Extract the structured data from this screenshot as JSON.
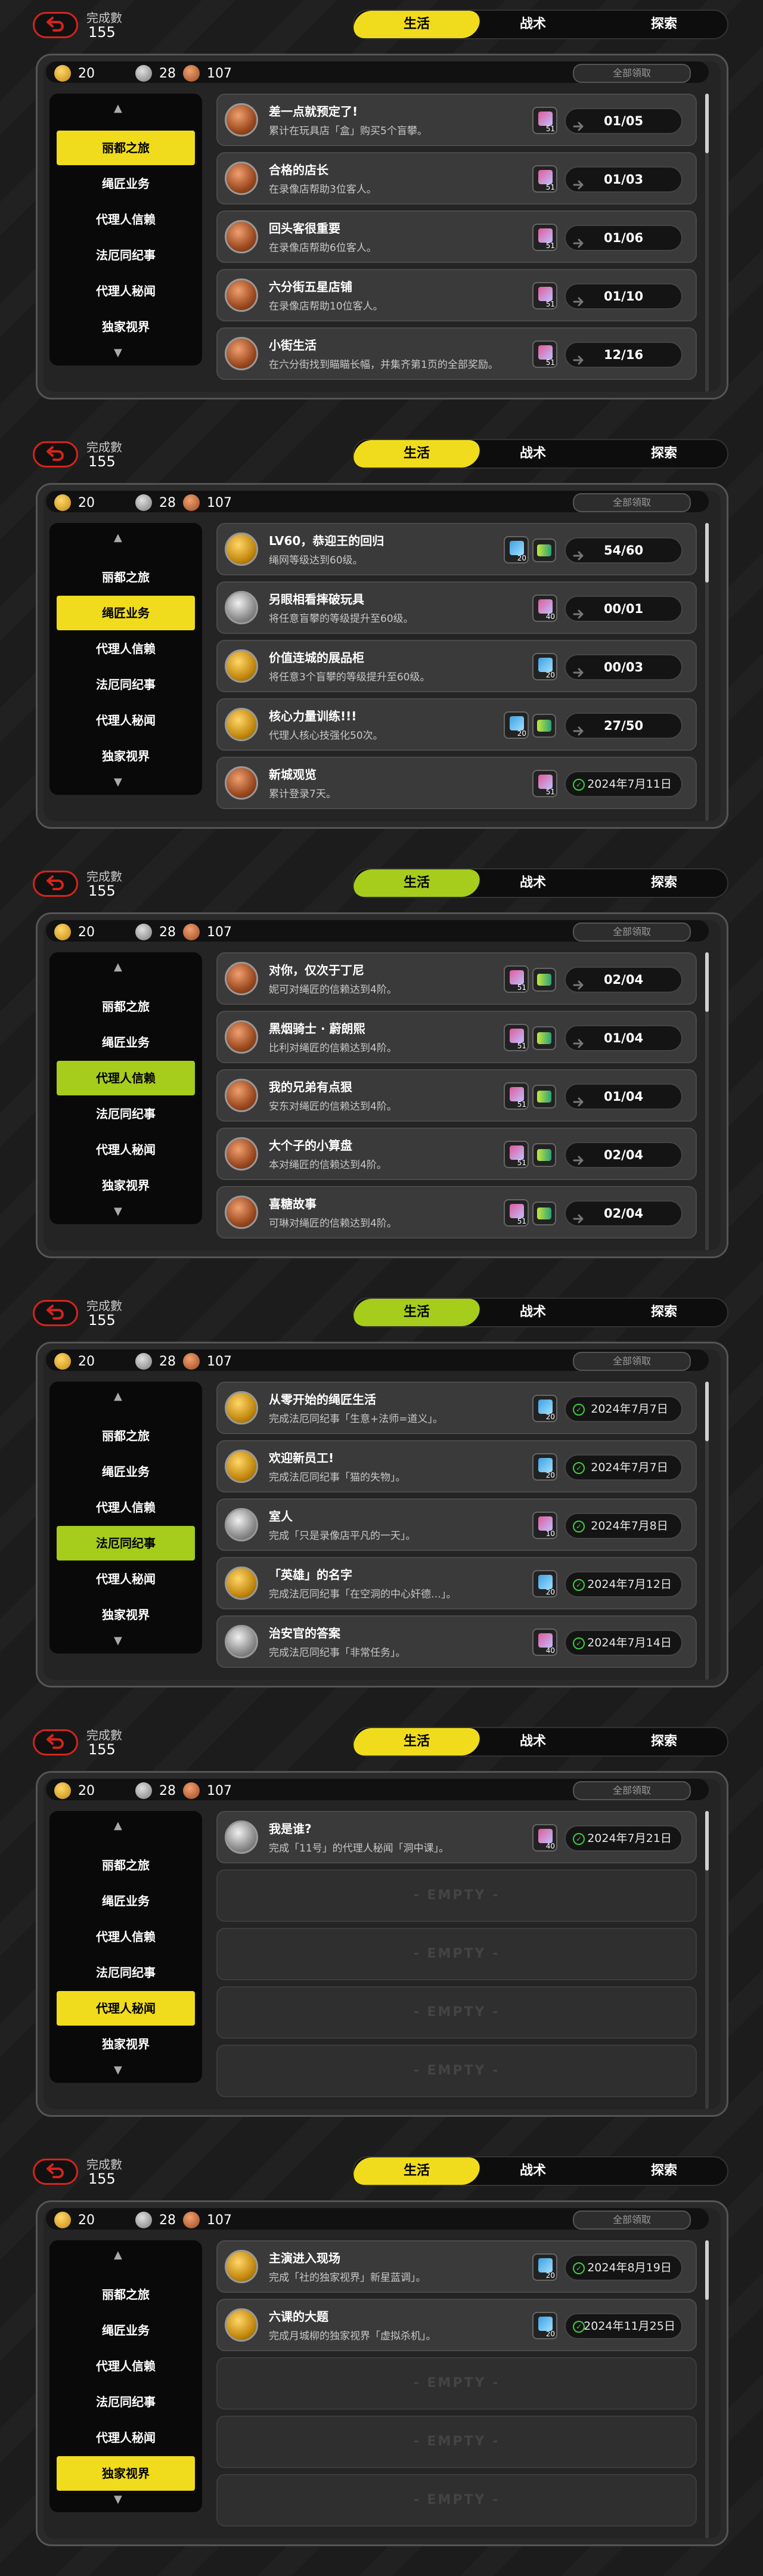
{
  "header": {
    "completed_label": "完成數",
    "completed_value": "155",
    "tabs": [
      "生活",
      "战术",
      "探索"
    ],
    "active_tab": "生活"
  },
  "currency": {
    "gold": "20",
    "silver": "28",
    "bronze": "107",
    "claim_all_label": "全部領取"
  },
  "categories": [
    "丽都之旅",
    "绳匠业务",
    "代理人信赖",
    "法厄同纪事",
    "代理人秘闻",
    "独家视界"
  ],
  "empty_label": "- EMPTY -",
  "colors": {
    "accent_yellow": "#f0dc1c",
    "accent_green": "#a6cc1c",
    "back_red": "#d5241c"
  },
  "panels": [
    {
      "active_category": "丽都之旅",
      "accent": "#f0dc1c",
      "tasks": [
        {
          "title": "差一点就预定了!",
          "desc": "累计在玩具店「盒」购买5个盲攀。",
          "reward_num": "51",
          "progress": "01/05",
          "medal": "bronze"
        },
        {
          "title": "合格的店长",
          "desc": "在录像店帮助3位客人。",
          "reward_num": "51",
          "progress": "01/03",
          "medal": "bronze"
        },
        {
          "title": "回头客很重要",
          "desc": "在录像店帮助6位客人。",
          "reward_num": "51",
          "progress": "01/06",
          "medal": "bronze"
        },
        {
          "title": "六分街五星店铺",
          "desc": "在录像店帮助10位客人。",
          "reward_num": "51",
          "progress": "01/10",
          "medal": "bronze"
        },
        {
          "title": "小街生活",
          "desc": "在六分街找到瞄瞄长幅，并集齐第1页的全部奖励。",
          "reward_num": "51",
          "progress": "12/16",
          "medal": "bronze"
        }
      ]
    },
    {
      "active_category": "绳匠业务",
      "accent": "#f0dc1c",
      "tasks": [
        {
          "title": "LV60，恭迎王的回归",
          "desc": "绳网等级达到60级。",
          "reward_num": "20",
          "progress": "54/60",
          "medal": "gold",
          "double": true
        },
        {
          "title": "另眼相看摔破玩具",
          "desc": "将任意盲攀的等级提升至60级。",
          "reward_num": "40",
          "progress": "00/01",
          "medal": "silver"
        },
        {
          "title": "价值连城的展品柜",
          "desc": "将任意3个盲攀的等级提升至60级。",
          "reward_num": "20",
          "progress": "00/03",
          "medal": "gold"
        },
        {
          "title": "核心力量训练!!!",
          "desc": "代理人核心技强化50次。",
          "reward_num": "20",
          "progress": "27/50",
          "medal": "gold",
          "double": true
        },
        {
          "title": "新城观览",
          "desc": "累计登录7天。",
          "reward_num": "51",
          "progress": "2024年7月11日",
          "medal": "bronze",
          "done": true
        }
      ]
    },
    {
      "active_category": "代理人信赖",
      "accent": "#a6cc1c",
      "tasks": [
        {
          "title": "对你，仅次于丁尼",
          "desc": "妮可对绳匠的信赖达到4阶。",
          "reward_num": "51",
          "progress": "02/04",
          "medal": "bronze",
          "double": true
        },
        {
          "title": "黑烟骑士 · 蔚朗熙",
          "desc": "比利对绳匠的信赖达到4阶。",
          "reward_num": "51",
          "progress": "01/04",
          "medal": "bronze",
          "double": true
        },
        {
          "title": "我的兄弟有点狠",
          "desc": "安东对绳匠的信赖达到4阶。",
          "reward_num": "51",
          "progress": "01/04",
          "medal": "bronze",
          "double": true
        },
        {
          "title": "大个子的小算盘",
          "desc": "本对绳匠的信赖达到4阶。",
          "reward_num": "51",
          "progress": "02/04",
          "medal": "bronze",
          "double": true
        },
        {
          "title": "喜糖故事",
          "desc": "可琳对绳匠的信赖达到4阶。",
          "reward_num": "51",
          "progress": "02/04",
          "medal": "bronze",
          "double": true
        }
      ]
    },
    {
      "active_category": "法厄同纪事",
      "accent": "#a6cc1c",
      "tasks": [
        {
          "title": "从零开始的绳匠生活",
          "desc": "完成法厄同纪事「生意+法师=道义」。",
          "reward_num": "20",
          "progress": "2024年7月7日",
          "medal": "gold",
          "done": true
        },
        {
          "title": "欢迎新员工!",
          "desc": "完成法厄同纪事「猫的失物」。",
          "reward_num": "20",
          "progress": "2024年7月7日",
          "medal": "gold",
          "done": true
        },
        {
          "title": "室人",
          "desc": "完成「只是录像店平凡的一天」。",
          "reward_num": "10",
          "progress": "2024年7月8日",
          "medal": "silver",
          "done": true
        },
        {
          "title": "「英雄」的名字",
          "desc": "完成法厄同纪事「在空洞的中心奸德…」。",
          "reward_num": "20",
          "progress": "2024年7月12日",
          "medal": "gold",
          "done": true
        },
        {
          "title": "治安官的答案",
          "desc": "完成法厄同纪事「非常任务」。",
          "reward_num": "40",
          "progress": "2024年7月14日",
          "medal": "silver",
          "done": true
        }
      ]
    },
    {
      "active_category": "代理人秘闻",
      "accent": "#f0dc1c",
      "tasks": [
        {
          "title": "我是谁?",
          "desc": "完成「11号」的代理人秘闻「洞中课」。",
          "reward_num": "40",
          "progress": "2024年7月21日",
          "medal": "silver",
          "done": true
        }
      ],
      "empty_count": 4
    },
    {
      "active_category": "独家视界",
      "accent": "#f0dc1c",
      "tasks": [
        {
          "title": "主演进入现场",
          "desc": "完成「社的独家视界」新星蓝调」。",
          "reward_num": "20",
          "progress": "2024年8月19日",
          "medal": "gold",
          "done": true
        },
        {
          "title": "六课的大题",
          "desc": "完成月城柳的独家视界「虚拟杀机」。",
          "reward_num": "20",
          "progress": "2024年11月25日",
          "medal": "gold",
          "done": true
        }
      ],
      "empty_count": 3
    }
  ]
}
